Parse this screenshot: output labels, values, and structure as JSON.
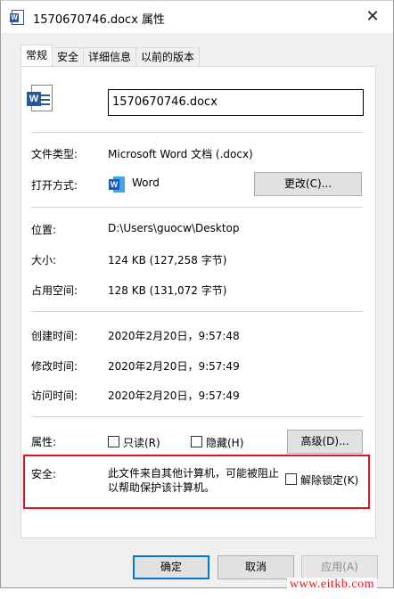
{
  "window": {
    "title": "1570670746.docx 属性",
    "close_glyph": "✕"
  },
  "tabs": [
    {
      "label": "常规",
      "active": true
    },
    {
      "label": "安全",
      "active": false
    },
    {
      "label": "详细信息",
      "active": false
    },
    {
      "label": "以前的版本",
      "active": false
    }
  ],
  "general": {
    "file_name": "1570670746.docx",
    "file_type_label": "文件类型:",
    "file_type_value": "Microsoft Word 文档 (.docx)",
    "open_with_label": "打开方式:",
    "open_with_value": "Word",
    "change_button": "更改(C)...",
    "location_label": "位置:",
    "location_value": "D:\\Users\\guocw\\Desktop",
    "size_label": "大小:",
    "size_value": "124 KB (127,258 字节)",
    "size_on_disk_label": "占用空间:",
    "size_on_disk_value": "128 KB (131,072 字节)",
    "created_label": "创建时间:",
    "created_value": "2020年2月20日，9:57:48",
    "modified_label": "修改时间:",
    "modified_value": "2020年2月20日，9:57:49",
    "accessed_label": "访问时间:",
    "accessed_value": "2020年2月20日，9:57:49",
    "attributes_label": "属性:",
    "readonly_label": "只读(R)",
    "readonly_checked": false,
    "hidden_label": "隐藏(H)",
    "hidden_checked": false,
    "advanced_button": "高级(D)...",
    "security_label": "安全:",
    "security_text_line1": "此文件来自其他计算机，可能被阻止",
    "security_text_line2": "以帮助保护该计算机。",
    "unblock_label": "解除锁定(K)",
    "unblock_checked": false
  },
  "footer": {
    "ok_button": "确定",
    "cancel_button": "取消",
    "apply_button": "应用(A)"
  },
  "watermark": "www.eitkb.com",
  "icons": {
    "app_icon": "word-document-icon",
    "file_icon": "word-document-icon",
    "open_with_icon": "word-app-icon"
  },
  "colors": {
    "word_blue": "#2b579a",
    "highlight_red": "#e0141e",
    "focus_blue": "#0078d7"
  }
}
